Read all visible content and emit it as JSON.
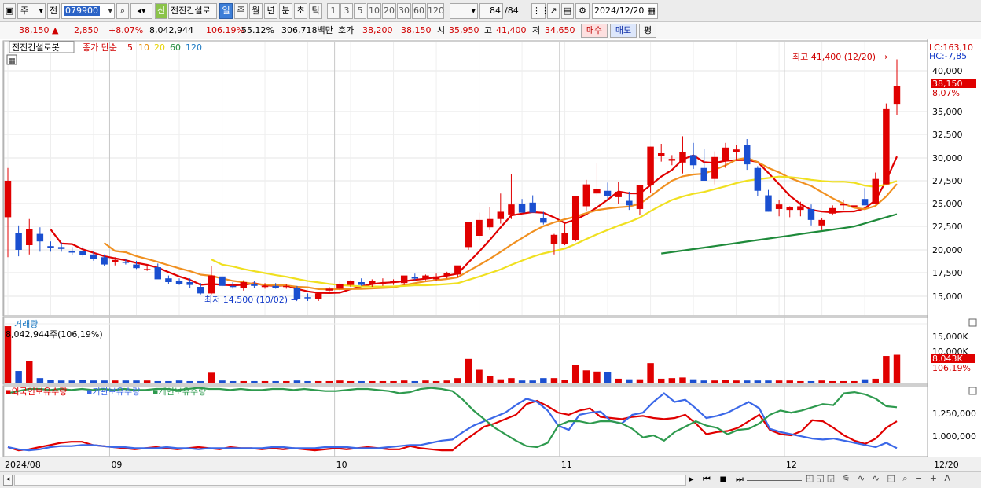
{
  "toolbar": {
    "market_label": "주",
    "prefix_label": "전",
    "stock_code": "079900",
    "new_label": "신",
    "stock_name": "전진건설로",
    "period_tabs": [
      "일",
      "주",
      "월",
      "년",
      "분",
      "초",
      "틱"
    ],
    "active_period": "일",
    "interval_buttons": [
      "1",
      "3",
      "5",
      "10",
      "20",
      "30",
      "60",
      "120"
    ],
    "count_value": "84",
    "count_total": "/84",
    "date_value": "2024/12/20"
  },
  "quote": {
    "price": "38,150",
    "change": "2,850",
    "change_pct": "+8.07%",
    "volume": "8,042,944",
    "volume_ratio": "106.19%",
    "turnover": "55.12%",
    "amount": "306,718백만",
    "ask_label": "호가",
    "ask1": "38,200",
    "bid1": "38,150",
    "open_label": "시",
    "open": "35,950",
    "high_label": "고",
    "high": "41,400",
    "low_label": "저",
    "low": "34,650",
    "buy_label": "매수",
    "sell_label": "매도",
    "eval_label": "평"
  },
  "price_panel": {
    "stock_label": "전진건설로봇",
    "indicator_label": "종가 단순",
    "ma_labels": [
      "5",
      "10",
      "20",
      "60",
      "120"
    ],
    "lc_label": "LC:163,10",
    "hc_label": "HC:-7,85",
    "current_price_tag": "38,150",
    "current_pct_tag": "8,07%",
    "high_annotation": "최고 41,400 (12/20)",
    "low_annotation": "최저 14,500 (10/02)"
  },
  "volume_panel": {
    "title": "거래량",
    "readout": "8,042,944주(106,19%)",
    "current_tag": "8,043K",
    "current_pct_tag": "106,19%"
  },
  "holding_panel": {
    "series_labels": [
      "외국인보유수량",
      "기관보유수량",
      "개인보유수량"
    ],
    "series_colors": [
      "#e00000",
      "#3b68e8",
      "#2e9a4e"
    ]
  },
  "x_axis": {
    "labels": [
      "2024/08",
      "09",
      "10",
      "11",
      "12"
    ],
    "right_label": "12/20"
  },
  "chart_data": {
    "type": "candlestick",
    "price_axis": {
      "ticks": [
        15000,
        17500,
        20000,
        22500,
        25000,
        27500,
        30000,
        32500,
        35000,
        38150,
        40000
      ]
    },
    "volume_axis": {
      "ticks": [
        "10,000K",
        "15,000K"
      ]
    },
    "holding_axis": {
      "ticks": [
        "1,000,000",
        "1,250,000"
      ]
    },
    "candles": [
      [
        23500,
        28900,
        19200,
        27500
      ],
      [
        21800,
        22600,
        19300,
        20000
      ],
      [
        20500,
        23300,
        19500,
        22200
      ],
      [
        21700,
        22400,
        19800,
        20900
      ],
      [
        20400,
        20900,
        19800,
        20200
      ],
      [
        20300,
        20800,
        19800,
        20100
      ],
      [
        19900,
        20300,
        19400,
        19700
      ],
      [
        19900,
        20400,
        19200,
        19400
      ],
      [
        19500,
        19900,
        18800,
        19000
      ],
      [
        19200,
        19500,
        18200,
        18400
      ],
      [
        18700,
        19200,
        18300,
        18900
      ],
      [
        18700,
        19000,
        18400,
        18600
      ],
      [
        18400,
        18800,
        17900,
        18000
      ],
      [
        17900,
        18300,
        17700,
        17900
      ],
      [
        18100,
        18500,
        17300,
        16800
      ],
      [
        16900,
        17200,
        16300,
        16500
      ],
      [
        16600,
        16900,
        16200,
        16300
      ],
      [
        16500,
        16900,
        15900,
        16200
      ],
      [
        16000,
        16400,
        15200,
        15300
      ],
      [
        15300,
        18200,
        15200,
        17200
      ],
      [
        17100,
        17400,
        15900,
        16100
      ],
      [
        16100,
        16500,
        15800,
        16000
      ],
      [
        15900,
        16700,
        15600,
        16500
      ],
      [
        16300,
        16600,
        15900,
        16100
      ],
      [
        16000,
        16400,
        15800,
        16100
      ],
      [
        16100,
        16400,
        15800,
        15900
      ],
      [
        16000,
        16300,
        15800,
        16100
      ],
      [
        15900,
        16100,
        14700,
        14700
      ],
      [
        14900,
        15300,
        14500,
        14800
      ],
      [
        14700,
        15300,
        14500,
        15300
      ],
      [
        15600,
        16000,
        15500,
        15800
      ],
      [
        15800,
        16600,
        15500,
        16300
      ],
      [
        16200,
        16700,
        16000,
        16600
      ],
      [
        16500,
        16900,
        16100,
        16200
      ],
      [
        16300,
        16800,
        16000,
        16600
      ],
      [
        16400,
        16900,
        16100,
        16400
      ],
      [
        16500,
        16800,
        16200,
        16600
      ],
      [
        16400,
        17100,
        16200,
        17200
      ],
      [
        17000,
        17400,
        16700,
        16900
      ],
      [
        16900,
        17300,
        16700,
        17200
      ],
      [
        16800,
        17400,
        16600,
        17100
      ],
      [
        17200,
        17600,
        16900,
        17500
      ],
      [
        17300,
        18200,
        17000,
        18300
      ],
      [
        20300,
        23000,
        20000,
        23000
      ],
      [
        21500,
        24000,
        21000,
        23200
      ],
      [
        22400,
        24600,
        22100,
        23300
      ],
      [
        23300,
        26100,
        22800,
        24100
      ],
      [
        23800,
        28200,
        23300,
        24900
      ],
      [
        25000,
        25500,
        24000,
        24000
      ],
      [
        25100,
        25900,
        24800,
        24000
      ],
      [
        23400,
        24100,
        22700,
        22900
      ],
      [
        20600,
        21700,
        19500,
        21600
      ],
      [
        20600,
        22800,
        20500,
        21800
      ],
      [
        21000,
        24900,
        20900,
        25800
      ],
      [
        24700,
        27600,
        24200,
        27100
      ],
      [
        26100,
        29400,
        25900,
        26600
      ],
      [
        26400,
        27300,
        25400,
        25800
      ],
      [
        25700,
        27400,
        25000,
        26300
      ],
      [
        25300,
        26300,
        24300,
        24800
      ],
      [
        24400,
        25800,
        23700,
        27000
      ],
      [
        27000,
        31200,
        26200,
        31200
      ],
      [
        30200,
        31500,
        29600,
        30500
      ],
      [
        29700,
        30300,
        29200,
        29900
      ],
      [
        29500,
        32300,
        28300,
        30600
      ],
      [
        30300,
        31600,
        28800,
        29200
      ],
      [
        28900,
        31000,
        27700,
        27500
      ],
      [
        27700,
        30700,
        27100,
        30100
      ],
      [
        29700,
        31600,
        28900,
        31100
      ],
      [
        30600,
        31400,
        29700,
        30900
      ],
      [
        31400,
        32000,
        28700,
        29300
      ],
      [
        28900,
        29100,
        25800,
        26400
      ],
      [
        25900,
        26500,
        24100,
        24100
      ],
      [
        24400,
        25400,
        23600,
        24900
      ],
      [
        24300,
        24700,
        23500,
        24600
      ],
      [
        24300,
        25200,
        23600,
        24700
      ],
      [
        24400,
        24900,
        22600,
        23200
      ],
      [
        22600,
        23400,
        22100,
        23200
      ],
      [
        23900,
        24800,
        23700,
        24500
      ],
      [
        24800,
        25400,
        24300,
        25000
      ],
      [
        24600,
        25600,
        23800,
        24800
      ],
      [
        25500,
        26700,
        25300,
        24800
      ],
      [
        25000,
        28400,
        24900,
        27700
      ],
      [
        27100,
        36000,
        27100,
        35300
      ],
      [
        35950,
        41400,
        34650,
        38150
      ]
    ],
    "volume": [
      9.6,
      2.1,
      3.8,
      0.9,
      0.6,
      0.5,
      0.5,
      0.6,
      0.5,
      0.5,
      0.5,
      0.5,
      0.5,
      0.5,
      0.4,
      0.4,
      0.5,
      0.4,
      0.4,
      1.8,
      0.5,
      0.4,
      0.4,
      0.4,
      0.4,
      0.4,
      0.4,
      0.5,
      0.4,
      0.4,
      0.4,
      0.5,
      0.4,
      0.4,
      0.4,
      0.4,
      0.4,
      0.5,
      0.4,
      0.5,
      0.4,
      0.5,
      0.9,
      4.1,
      2.3,
      1.3,
      0.7,
      0.9,
      0.5,
      0.5,
      0.9,
      0.9,
      0.6,
      3.1,
      2.2,
      2.0,
      1.9,
      0.8,
      0.7,
      0.7,
      3.4,
      0.8,
      0.9,
      1.0,
      0.7,
      0.5,
      0.5,
      0.6,
      0.5,
      0.5,
      0.5,
      0.5,
      0.5,
      0.5,
      0.4,
      0.4,
      0.5,
      0.4,
      0.4,
      0.4,
      0.7,
      0.8,
      4.6,
      4.8
    ],
    "holdings": {
      "foreign": [
        0.88,
        0.85,
        0.86,
        0.88,
        0.9,
        0.92,
        0.93,
        0.93,
        0.9,
        0.89,
        0.88,
        0.87,
        0.86,
        0.87,
        0.88,
        0.87,
        0.86,
        0.87,
        0.88,
        0.87,
        0.86,
        0.88,
        0.87,
        0.87,
        0.86,
        0.87,
        0.86,
        0.87,
        0.86,
        0.85,
        0.86,
        0.87,
        0.86,
        0.87,
        0.88,
        0.87,
        0.86,
        0.86,
        0.89,
        0.87,
        0.86,
        0.85,
        0.85,
        0.93,
        1.0,
        1.07,
        1.1,
        1.14,
        1.18,
        1.28,
        1.31,
        1.26,
        1.2,
        1.18,
        1.22,
        1.24,
        1.16,
        1.15,
        1.14,
        1.16,
        1.17,
        1.15,
        1.14,
        1.15,
        1.18,
        1.1,
        1.0,
        1.02,
        1.03,
        1.06,
        1.12,
        1.18,
        1.04,
        1.0,
        0.99,
        1.03,
        1.13,
        1.12,
        1.06,
        0.99,
        0.94,
        0.91,
        0.96,
        1.06,
        1.12
      ],
      "institution": [
        0.88,
        0.86,
        0.85,
        0.86,
        0.88,
        0.89,
        0.89,
        0.9,
        0.9,
        0.89,
        0.88,
        0.88,
        0.87,
        0.87,
        0.87,
        0.88,
        0.87,
        0.87,
        0.86,
        0.87,
        0.87,
        0.87,
        0.87,
        0.87,
        0.87,
        0.88,
        0.88,
        0.87,
        0.87,
        0.87,
        0.88,
        0.88,
        0.88,
        0.87,
        0.87,
        0.87,
        0.88,
        0.89,
        0.9,
        0.9,
        0.92,
        0.94,
        0.95,
        1.02,
        1.08,
        1.12,
        1.16,
        1.2,
        1.27,
        1.33,
        1.3,
        1.22,
        1.08,
        1.04,
        1.18,
        1.2,
        1.21,
        1.12,
        1.1,
        1.18,
        1.2,
        1.3,
        1.38,
        1.3,
        1.32,
        1.24,
        1.15,
        1.17,
        1.2,
        1.25,
        1.3,
        1.24,
        1.05,
        1.02,
        1.0,
        0.98,
        0.96,
        0.95,
        0.96,
        0.94,
        0.92,
        0.9,
        0.88,
        0.92,
        0.87
      ],
      "individual": [
        1.38,
        1.4,
        1.42,
        1.42,
        1.41,
        1.42,
        1.41,
        1.42,
        1.41,
        1.42,
        1.41,
        1.42,
        1.41,
        1.41,
        1.42,
        1.42,
        1.41,
        1.42,
        1.43,
        1.42,
        1.42,
        1.41,
        1.42,
        1.41,
        1.41,
        1.42,
        1.42,
        1.41,
        1.42,
        1.41,
        1.4,
        1.4,
        1.41,
        1.42,
        1.42,
        1.41,
        1.4,
        1.38,
        1.39,
        1.42,
        1.43,
        1.42,
        1.4,
        1.32,
        1.22,
        1.14,
        1.06,
        1.0,
        0.94,
        0.89,
        0.88,
        0.92,
        1.08,
        1.12,
        1.12,
        1.1,
        1.12,
        1.12,
        1.1,
        1.05,
        0.97,
        0.99,
        0.94,
        1.02,
        1.07,
        1.12,
        1.08,
        1.06,
        1.0,
        1.04,
        1.05,
        1.1,
        1.18,
        1.22,
        1.2,
        1.22,
        1.25,
        1.28,
        1.27,
        1.38,
        1.39,
        1.37,
        1.33,
        1.26,
        1.25
      ]
    }
  }
}
